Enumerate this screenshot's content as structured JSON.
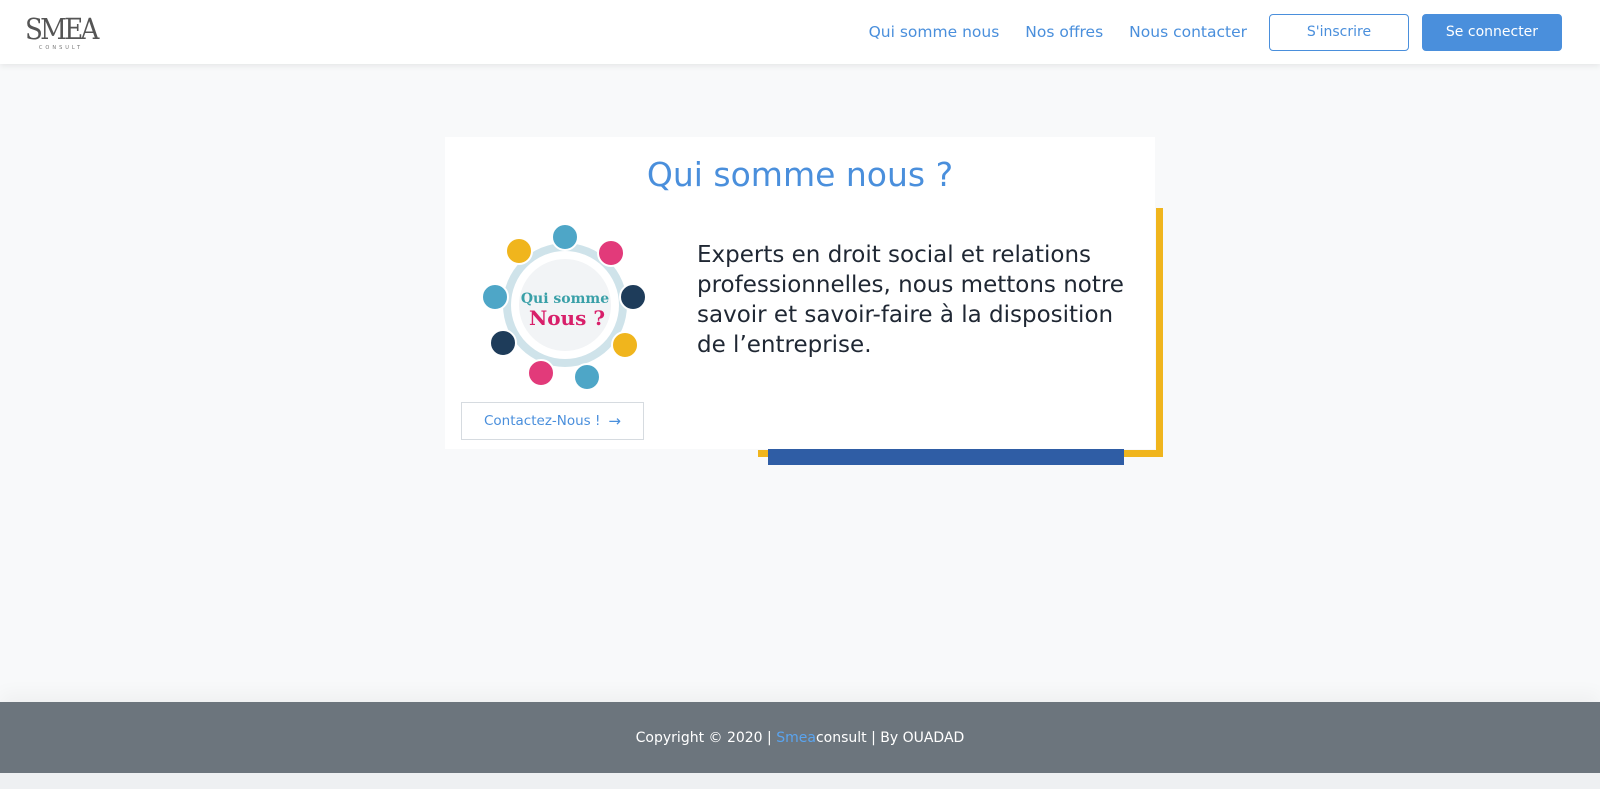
{
  "header": {
    "logo_text": "SMEA",
    "logo_subtext": "CONSULT",
    "nav": [
      {
        "label": "Qui somme nous"
      },
      {
        "label": "Nos offres"
      },
      {
        "label": "Nous contacter"
      }
    ],
    "signup_label": "S'inscrire",
    "login_label": "Se connecter"
  },
  "main": {
    "title": "Qui somme nous ?",
    "illustration": {
      "line1": "Qui somme",
      "line2": "Nous ?"
    },
    "contact_button_label": "Contactez-Nous !",
    "contact_button_icon": "→",
    "description": "Experts en droit social et relations professionnelles, nous mettons notre savoir et savoir-faire à la disposition de l’entreprise."
  },
  "footer": {
    "prefix": "Copyright © 2020 | ",
    "brand": "Smea",
    "brand_suffix": "consult",
    "suffix": " | By OUADAD"
  },
  "colors": {
    "accent": "#4a8fdc",
    "yellow": "#f0b51d",
    "dark_blue": "#2f5da5",
    "footer_bg": "#6c757d"
  }
}
